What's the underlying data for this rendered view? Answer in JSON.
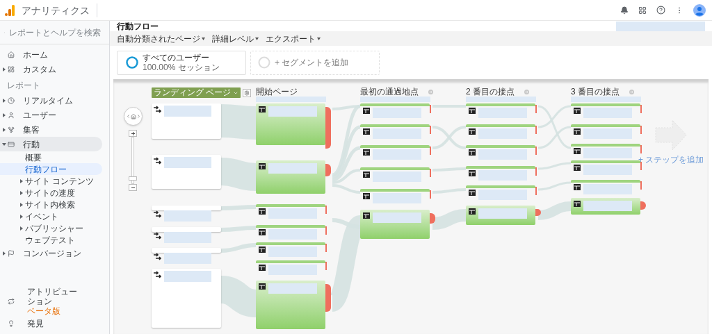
{
  "app": {
    "title": "アナリティクス"
  },
  "sidebar": {
    "search": {
      "placeholder": "レポートとヘルプを検索"
    },
    "top_items": [
      {
        "label": "ホーム",
        "expandable": false
      },
      {
        "label": "カスタム",
        "expandable": true
      }
    ],
    "section_label": "レポート",
    "report_items": [
      {
        "label": "リアルタイム",
        "expanded": false,
        "selected": false
      },
      {
        "label": "ユーザー",
        "expanded": false,
        "selected": false
      },
      {
        "label": "集客",
        "expanded": false,
        "selected": false
      },
      {
        "label": "行動",
        "expanded": true,
        "selected": true,
        "children": [
          {
            "label": "概要",
            "expandable": false,
            "selected": false
          },
          {
            "label": "行動フロー",
            "expandable": false,
            "selected": true
          },
          {
            "label": "サイト コンテンツ",
            "expandable": true,
            "selected": false
          },
          {
            "label": "サイトの速度",
            "expandable": true,
            "selected": false
          },
          {
            "label": "サイト内検索",
            "expandable": true,
            "selected": false
          },
          {
            "label": "イベント",
            "expandable": true,
            "selected": false
          },
          {
            "label": "パブリッシャー",
            "expandable": true,
            "selected": false
          },
          {
            "label": "ウェブテスト",
            "expandable": false,
            "selected": false
          }
        ]
      },
      {
        "label": "コンバージョン",
        "expanded": false,
        "selected": false
      }
    ],
    "bottom_items": [
      {
        "label": "アトリビューション",
        "badge": "ベータ版"
      },
      {
        "label": "発見"
      }
    ]
  },
  "page": {
    "title": "行動フロー",
    "toolbar": [
      {
        "label": "自動分類されたページ"
      },
      {
        "label": "詳細レベル"
      },
      {
        "label": "エクスポート"
      }
    ],
    "segments": [
      {
        "kind": "active",
        "name": "すべてのユーザー",
        "detail": "100.00% セッション"
      },
      {
        "kind": "add",
        "label": "+ セグメントを追加"
      }
    ]
  },
  "flow": {
    "landing_selector": "ランディング ページ",
    "zoom": {
      "level": 0.1
    },
    "columns": [
      {
        "kind": "start",
        "title": "開始ページ"
      },
      {
        "kind": "step",
        "title": "最初の通過地点"
      },
      {
        "kind": "step",
        "title": "2 番目の接点"
      },
      {
        "kind": "step",
        "title": "3 番目の接点"
      }
    ],
    "add_step": "+ ステップを追加"
  }
}
